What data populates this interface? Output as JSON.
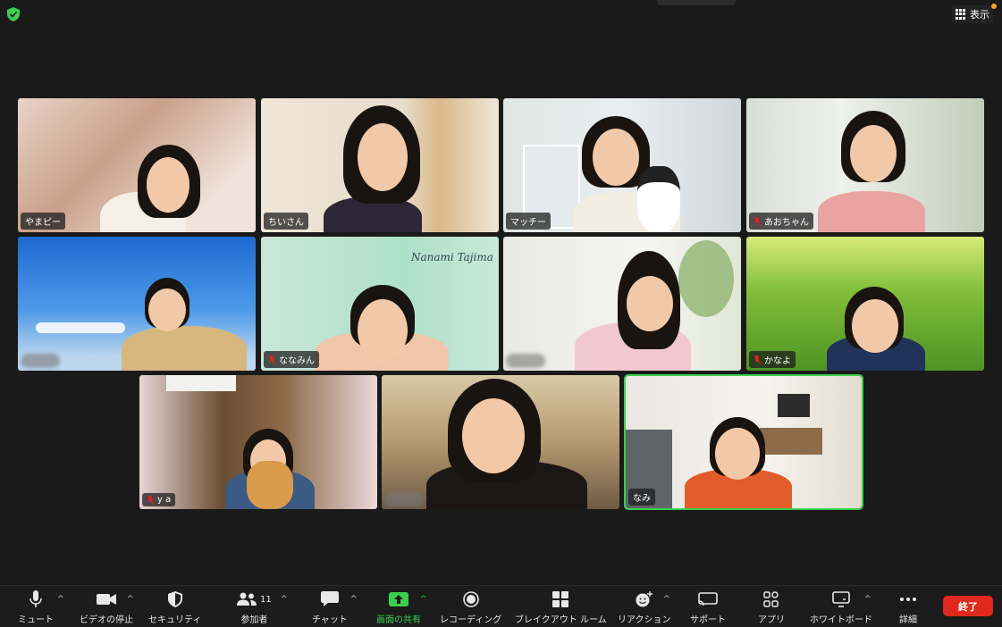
{
  "top_bar": {
    "view_label": "表示"
  },
  "participants": [
    {
      "name": "やまピー",
      "muted": false
    },
    {
      "name": "ちいさん",
      "muted": false
    },
    {
      "name": "マッチー",
      "muted": false
    },
    {
      "name": "あおちゃん",
      "muted": true
    },
    {
      "name": "",
      "muted": true,
      "name_blurred": true
    },
    {
      "name": "ななみん",
      "muted": true,
      "background_text": "Nanami Tajima"
    },
    {
      "name": "",
      "muted": true,
      "name_blurred": true
    },
    {
      "name": "かなよ",
      "muted": true
    },
    {
      "name": "y          a",
      "muted": true,
      "name_partially_blurred": true
    },
    {
      "name": "",
      "muted": false,
      "name_blurred": true
    },
    {
      "name": "なみ",
      "muted": false,
      "active_speaker": true
    }
  ],
  "toolbar": {
    "mute": "ミュート",
    "video": "ビデオの停止",
    "security": "セキュリティ",
    "participants": "参加者",
    "participants_count": "11",
    "chat": "チャット",
    "share": "画面の共有",
    "record": "レコーディング",
    "breakout": "ブレイクアウト ルーム",
    "reactions": "リアクション",
    "support": "サポート",
    "apps": "アプリ",
    "whiteboard": "ホワイトボード",
    "more": "詳細",
    "end": "終了"
  },
  "colors": {
    "accent_green": "#3ccf4e",
    "end_red": "#e0281e",
    "background": "#1a1a1a"
  }
}
